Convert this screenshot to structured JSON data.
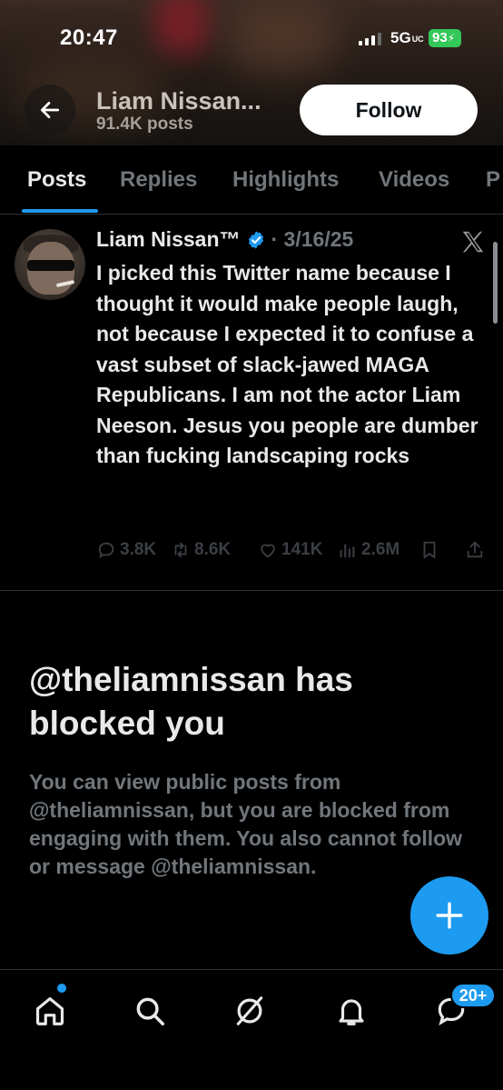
{
  "status_bar": {
    "time": "20:47",
    "network": "5G",
    "network_sub": "UC",
    "battery": "93"
  },
  "header": {
    "name": "Liam Nissan...",
    "posts": "91.4K posts",
    "follow_label": "Follow"
  },
  "tabs": [
    {
      "label": "Posts",
      "active": true
    },
    {
      "label": "Replies",
      "active": false
    },
    {
      "label": "Highlights",
      "active": false
    },
    {
      "label": "Videos",
      "active": false
    },
    {
      "label": "P",
      "active": false
    }
  ],
  "post": {
    "author": "Liam Nissan™",
    "date": "· 3/16/25",
    "text": "I picked this Twitter name because I thought it would make people laugh, not because I expected it to confuse a vast subset of slack-jawed MAGA Republicans. I am not the actor Liam Neeson. Jesus you people are dumber than fucking landscaping rocks",
    "replies": "3.8K",
    "reposts": "8.6K",
    "likes": "141K",
    "views": "2.6M"
  },
  "blocked": {
    "title": "@theliamnissan has blocked you",
    "description": "You can view public posts from @theliamnissan, but you are blocked from engaging with them. You also cannot follow or message @theliamnissan."
  },
  "bottom_nav": {
    "messages_badge": "20+"
  },
  "colors": {
    "accent": "#1d9bf0",
    "background": "#000000",
    "text": "#e7e9ea",
    "muted": "#71767b",
    "battery": "#34c759"
  }
}
